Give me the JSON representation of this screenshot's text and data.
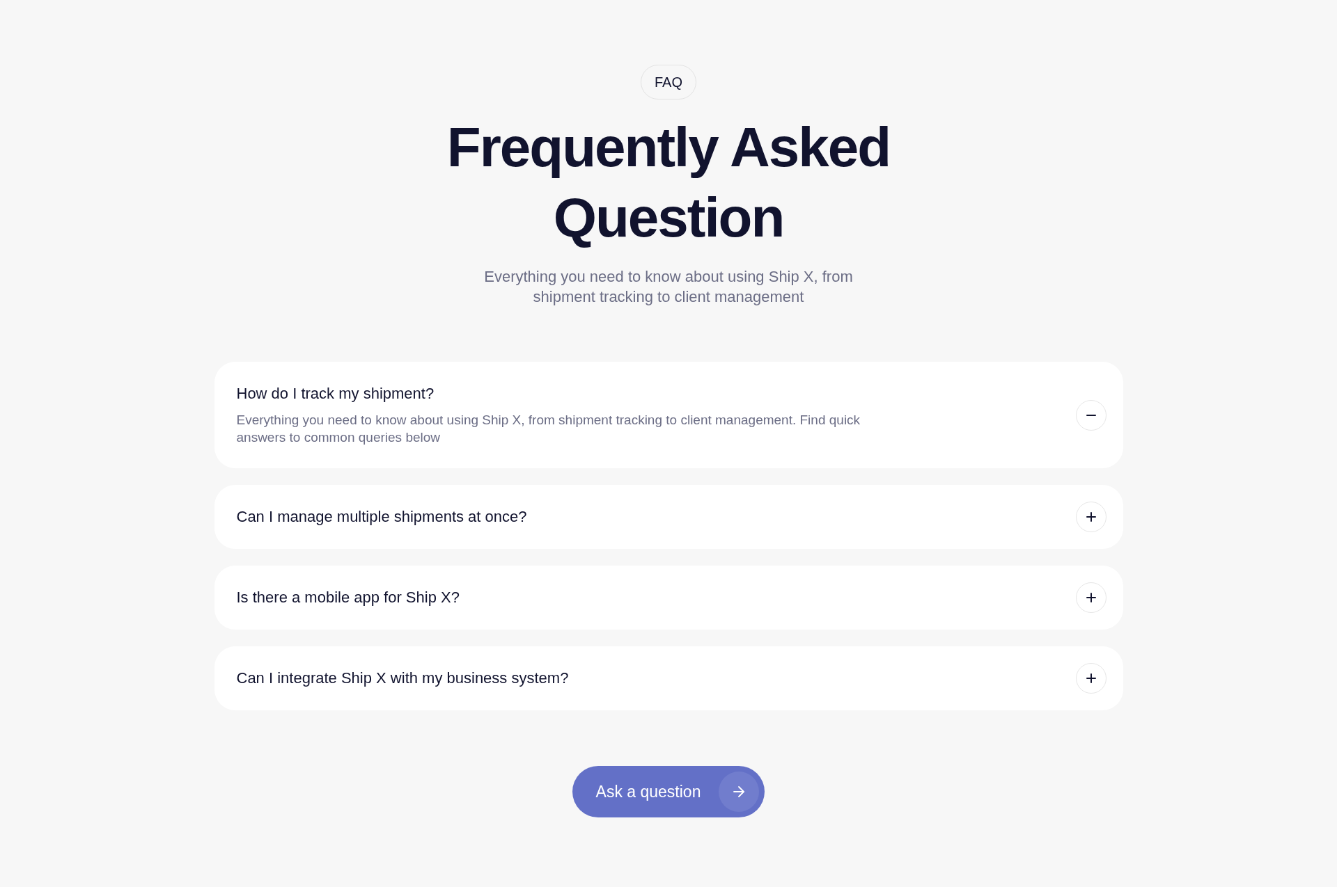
{
  "badge": "FAQ",
  "title": "Frequently Asked Question",
  "subtitle": "Everything you need to know about using Ship X, from shipment tracking to client management",
  "faq_items": [
    {
      "question": "How do I track my shipment?",
      "answer": "Everything you need to know about using Ship X, from shipment tracking to client management. Find quick answers to common queries below",
      "expanded": true
    },
    {
      "question": "Can I manage multiple shipments at once?",
      "expanded": false
    },
    {
      "question": "Is there a mobile app for Ship X?",
      "expanded": false
    },
    {
      "question": "Can I integrate Ship X with my business system?",
      "expanded": false
    }
  ],
  "cta_button": {
    "label": "Ask a question"
  }
}
